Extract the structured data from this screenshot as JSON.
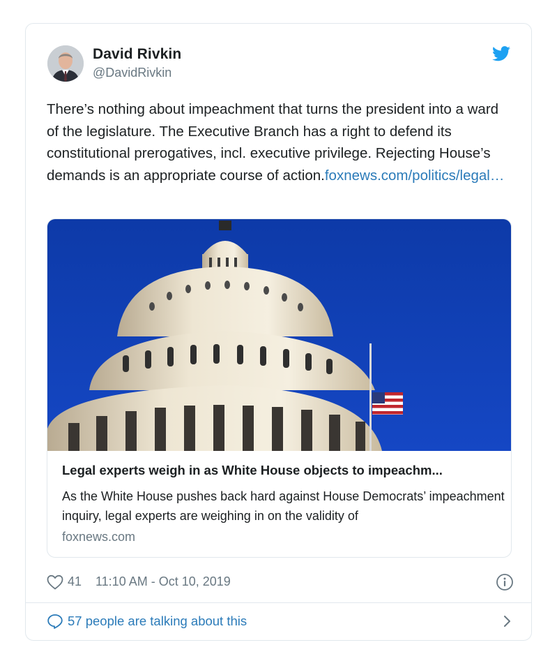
{
  "author": {
    "name": "David Rivkin",
    "handle": "@DavidRivkin"
  },
  "tweet": {
    "text": "There’s nothing about impeachment that turns the president into a ward of the legislature. The Executive Branch has a right to defend its constitutional prerogatives, incl. executive privilege. Rejecting House’s demands is an appropriate course of action.",
    "link_text": "foxnews.com/politics/legal…"
  },
  "card": {
    "title": "Legal experts weigh in as White House objects to impeachm...",
    "description": "As the White House pushes back hard against House Democrats’ impeachment inquiry, legal experts are weighing in on the validity of",
    "domain": "foxnews.com"
  },
  "meta": {
    "likes": "41",
    "timestamp": "11:10 AM - Oct 10, 2019"
  },
  "conversation": {
    "label": "57 people are talking about this"
  },
  "icons": {
    "brand": "twitter-bird-icon",
    "like": "heart-icon",
    "info": "info-icon",
    "reply": "speech-bubble-icon",
    "more": "chevron-right-icon"
  },
  "colors": {
    "text": "#1c2022",
    "secondary": "#697882",
    "link": "#2b7bb9",
    "twitter_blue": "#1da1f2",
    "border": "#e1e8ed",
    "sky": "#0f3fb0"
  }
}
